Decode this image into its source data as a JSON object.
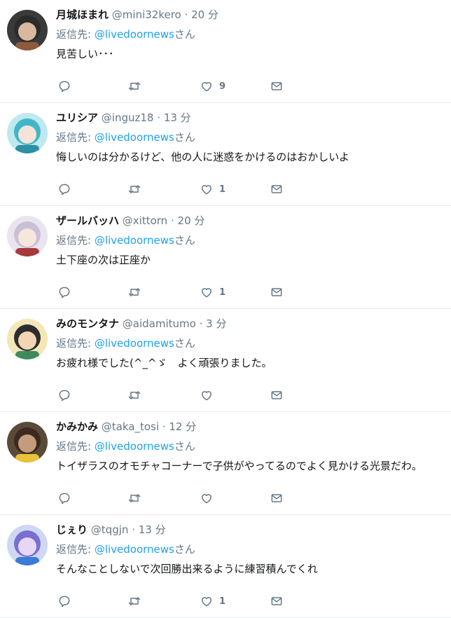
{
  "icons": [
    "reply-icon",
    "retweet-icon",
    "like-icon",
    "message-icon"
  ],
  "colors": {
    "link": "#1da1f2",
    "muted": "#657786",
    "text": "#14171a",
    "divider": "#e6ecf0"
  },
  "tweets": [
    {
      "name": "月城ほまれ",
      "handle": "@mini32kero",
      "dot": "·",
      "time": "20 分",
      "reply_prefix": "返信先: ",
      "reply_handle": "@livedoornews",
      "reply_suffix": "さん",
      "text": "見苦しい･･･",
      "likes": "9",
      "avatar": {
        "bg": "#3a3a3a",
        "skin": "#d9b8a0",
        "hair": "#2b2b2b",
        "accent": "#8e5a3c"
      }
    },
    {
      "name": "ユリシア",
      "handle": "@inguz18",
      "dot": "·",
      "time": "13 分",
      "reply_prefix": "返信先: ",
      "reply_handle": "@livedoornews",
      "reply_suffix": "さん",
      "text": "悔しいのは分かるけど、他の人に迷惑をかけるのはおかしいよ",
      "likes": "1",
      "avatar": {
        "bg": "#bfe8ef",
        "skin": "#f6e3d8",
        "hair": "#3fb7c9",
        "accent": "#2d8fa3"
      }
    },
    {
      "name": "ザールバッハ",
      "handle": "@xittorn",
      "dot": "·",
      "time": "20 分",
      "reply_prefix": "返信先: ",
      "reply_handle": "@livedoornews",
      "reply_suffix": "さん",
      "text": "土下座の次は正座か",
      "likes": "1",
      "avatar": {
        "bg": "#e9e4ee",
        "skin": "#f7e6dc",
        "hair": "#c8c0d6",
        "accent": "#a63a3a"
      }
    },
    {
      "name": "みのモンタナ",
      "handle": "@aidamitumo",
      "dot": "·",
      "time": "3 分",
      "reply_prefix": "返信先: ",
      "reply_handle": "@livedoornews",
      "reply_suffix": "さん",
      "text": "お疲れ様でした(^_^ゞ　よく頑張りました。",
      "likes": "",
      "avatar": {
        "bg": "#f3e7b8",
        "skin": "#f2d6b3",
        "hair": "#2d2d2d",
        "accent": "#3d8a5a"
      }
    },
    {
      "name": "かみかみ",
      "handle": "@taka_tosi",
      "dot": "·",
      "time": "12 分",
      "reply_prefix": "返信先: ",
      "reply_handle": "@livedoornews",
      "reply_suffix": "さん",
      "text": "トイザラスのオモチャコーナーで子供がやってるのでよく見かける光景だわ。",
      "likes": "",
      "avatar": {
        "bg": "#5a4a3a",
        "skin": "#c69b7b",
        "hair": "#3b2a1d",
        "accent": "#e8c23a"
      }
    },
    {
      "name": "じぇり",
      "handle": "@tqgjn",
      "dot": "·",
      "time": "13 分",
      "reply_prefix": "返信先: ",
      "reply_handle": "@livedoornews",
      "reply_suffix": "さん",
      "text": "そんなことしないで次回勝出来るように練習積んでくれ",
      "likes": "1",
      "avatar": {
        "bg": "#cfd8f2",
        "skin": "#e7d7f5",
        "hair": "#7a6fd0",
        "accent": "#3a7bd5"
      }
    }
  ]
}
